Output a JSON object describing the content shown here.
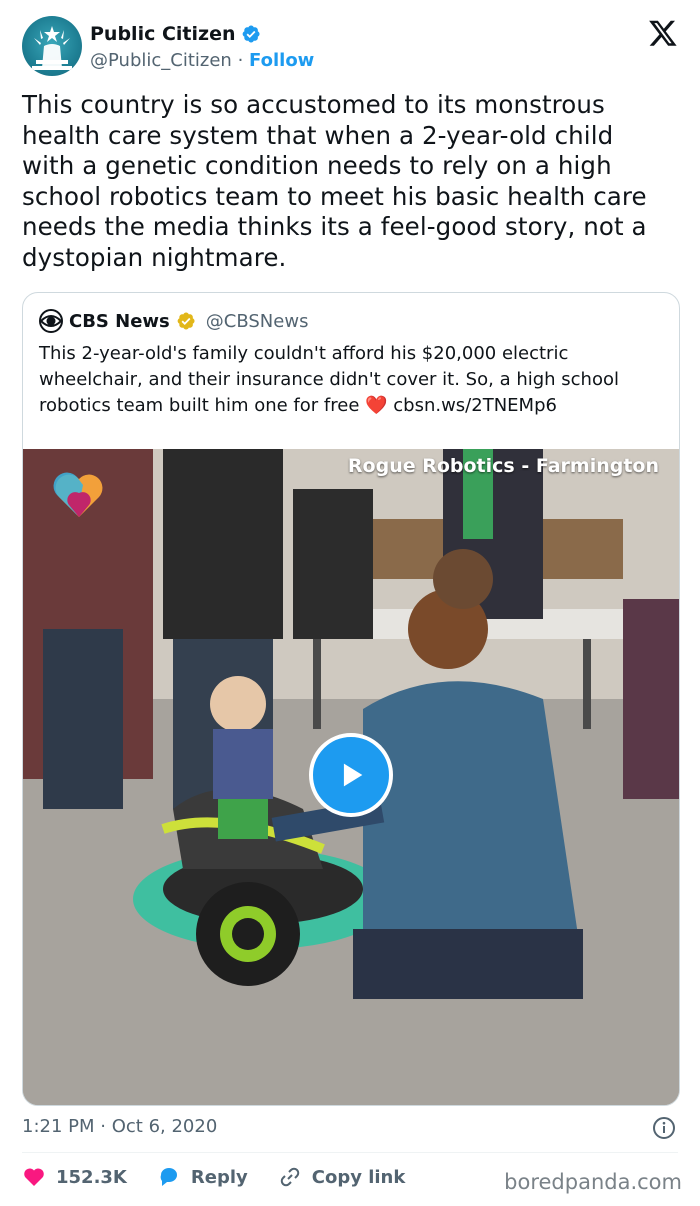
{
  "author": {
    "name": "Public Citizen",
    "handle": "@Public_Citizen",
    "separator": "·",
    "follow_label": "Follow"
  },
  "tweet": {
    "text": "This country is so accustomed to its monstrous\nhealth care system that when a 2-year-old child\nwith a genetic condition needs to rely on a high\nschool robotics team to meet his basic health care\nneeds the media thinks its a feel-good story, not a\ndystopian nightmare."
  },
  "quote": {
    "name": "CBS News",
    "handle": "@CBSNews",
    "text_before_heart": "This 2-year-old's family couldn't afford his $20,000 electric\nwheelchair, and their insurance didn't cover it. So, a high school\nrobotics team built him one for free ",
    "heart": "❤️",
    "link": " cbsn.ws/2TNEMp6",
    "video": {
      "overlay_title": "Rogue Robotics - Farmington"
    }
  },
  "meta": {
    "time": "1:21 PM",
    "separator": "·",
    "date": "Oct 6, 2020"
  },
  "actions": {
    "likes": "152.3K",
    "reply_label": "Reply",
    "copy_link_label": "Copy link"
  },
  "watermark": "boredpanda.com",
  "colors": {
    "accent": "#1d9bf0",
    "like": "#f91880",
    "muted": "#536471",
    "verified_gold": "#e2b719"
  }
}
